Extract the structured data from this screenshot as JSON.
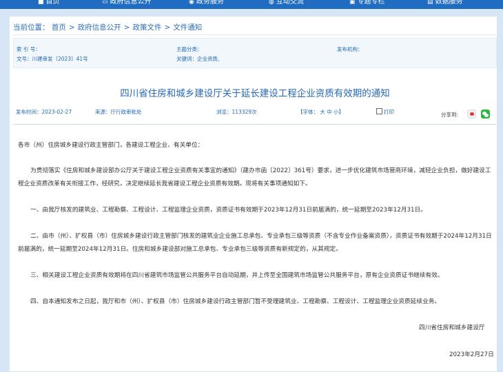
{
  "topnav": {
    "items": [
      {
        "icon": "home-icon",
        "label": "首页"
      },
      {
        "icon": "document-icon",
        "label": "政府信息公开"
      },
      {
        "icon": "service-icon",
        "label": "政务服务"
      },
      {
        "icon": "chat-icon",
        "label": "互动交流"
      },
      {
        "icon": "topic-icon",
        "label": "专题专栏"
      },
      {
        "icon": "data-icon",
        "label": "数据服务"
      }
    ]
  },
  "breadcrumb": {
    "label": "当前位置：",
    "items": [
      "首页",
      "政府信息公开",
      "政策文件",
      "文件通知"
    ],
    "separator": ">"
  },
  "meta": {
    "index_label": "索 引 号：",
    "index_value": "",
    "category_label": "主题分类：",
    "category_value": "",
    "issuer_label": "发布机构：",
    "issuer_value": "",
    "docno": "文号：川建审发〔2023〕41号",
    "keywords": "关键词：企业资质,"
  },
  "article": {
    "title": "四川省住房和城乡建设厅关于延长建设工程企业资质有效期的通知",
    "publish_date": "发布时间：2023-02-27",
    "source": "来源：厅行政审批处",
    "views": "浏览：113329次",
    "font_size": "【字体： 大 中 小】",
    "print": "打印",
    "share": "分享到:",
    "salutation": "各市（州）住房城乡建设行政主管部门，各建设工程企业、有关单位：",
    "p1": "为贯彻落实《住房和城乡建设部办公厅关于建设工程企业资质有关事宜的通知》（建办市函〔2022〕361号）要求，进一步优化建筑市场营商环境，减轻企业负担，做好建设工程企业资质改革有关衔接工作，经研究，决定继续延长我省建设工程企业资质有效期。现将有关事项通知如下。",
    "p2": "一、由我厅核发的建筑业、工程勘察、工程设计、工程监理企业资质，资质证书有效期于2023年12月31日前届满的，统一延期至2023年12月31日。",
    "p3": "二、由市（州）、扩权县（市）住房城乡建设行政主管部门核发的建筑业企业施工总承包、专业承包三级等资质（不含专业作业备案资质），资质证书有效期于2024年12月31日前届满的，统一延期至2024年12月31日。住房和城乡建设部对施工总承包、专业承包三级等资质有新规定的，从其规定。",
    "p4": "三、相关建设工程企业资质有效期将在四川省建筑市场监管公共服务平台自动延期，并上传至全国建筑市场监管公共服务平台，原有企业资质证书继续有效。",
    "p5": "四、自本通知发布之日起，我厅和市（州）、扩权县（市）住房城乡建设行政主管部门暂不受理建筑业、工程勘察、工程设计、工程监理企业资质延续业务。",
    "signature": "四川省住房和城乡建设厅",
    "date": "2023年2月27日"
  }
}
